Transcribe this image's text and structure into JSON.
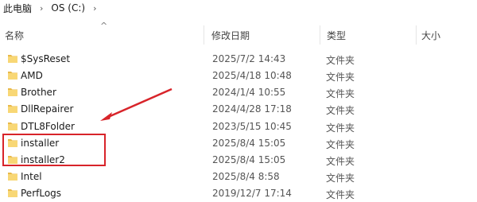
{
  "breadcrumb": {
    "items": [
      "此电脑",
      "OS (C:)"
    ],
    "separator": "›"
  },
  "columns": {
    "name": "名称",
    "modified": "修改日期",
    "type": "类型",
    "size": "大小"
  },
  "rows": [
    {
      "name": "$SysReset",
      "date": "2025/7/2 14:43",
      "type": "文件夹"
    },
    {
      "name": "AMD",
      "date": "2025/4/18 10:48",
      "type": "文件夹"
    },
    {
      "name": "Brother",
      "date": "2024/1/4 10:55",
      "type": "文件夹"
    },
    {
      "name": "DllRepairer",
      "date": "2024/4/28 17:18",
      "type": "文件夹"
    },
    {
      "name": "DTL8Folder",
      "date": "2023/5/15 10:45",
      "type": "文件夹"
    },
    {
      "name": "installer",
      "date": "2025/8/4 15:05",
      "type": "文件夹"
    },
    {
      "name": "installer2",
      "date": "2025/8/4 15:05",
      "type": "文件夹"
    },
    {
      "name": "Intel",
      "date": "2025/8/4 8:58",
      "type": "文件夹"
    },
    {
      "name": "PerfLogs",
      "date": "2019/12/7 17:14",
      "type": "文件夹"
    }
  ],
  "icons": {
    "folder": "folder-icon",
    "sort": "sort-up-caret-icon",
    "breadcrumb_separator": "chevron-right-icon"
  },
  "colors": {
    "folder_yellow": "#f8d775",
    "folder_dark": "#e8b94a",
    "annotation_red": "#d8242a"
  }
}
